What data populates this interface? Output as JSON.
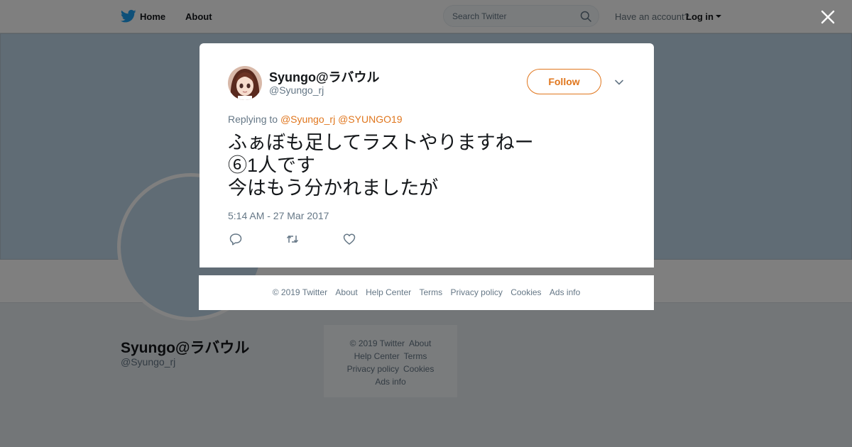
{
  "topbar": {
    "home_label": "Home",
    "about_label": "About",
    "search_placeholder": "Search Twitter",
    "have_account": "Have an account?",
    "login_label": "Log in"
  },
  "profile": {
    "name": "Syungo@ラバウル",
    "handle": "@Syungo_rj"
  },
  "side_footer": {
    "links": [
      "© 2019 Twitter",
      "About",
      "Help Center",
      "Terms",
      "Privacy policy",
      "Cookies",
      "Ads info"
    ]
  },
  "tweet": {
    "author_name": "Syungo@ラバウル",
    "author_handle": "@Syungo_rj",
    "follow_label": "Follow",
    "replying_prefix": "Replying to",
    "mentions": [
      "@Syungo_rj",
      "@SYUNGO19"
    ],
    "text_lines": [
      "ふぁぼも足してラストやりますねー",
      "⑥1人です",
      "今はもう分かれましたが"
    ],
    "timestamp": "5:14 AM - 27 Mar 2017"
  },
  "modal_footer": {
    "links": [
      "© 2019 Twitter",
      "About",
      "Help Center",
      "Terms",
      "Privacy policy",
      "Cookies",
      "Ads info"
    ]
  },
  "colors": {
    "accent": "#e0761d",
    "twitter_blue": "#1da1f2",
    "text_primary": "#14171a",
    "text_secondary": "#657786"
  },
  "icons": {
    "logo": "twitter-bird-icon",
    "search": "search-icon",
    "close": "close-icon",
    "dropdown": "chevron-down-icon",
    "reply": "reply-icon",
    "retweet": "retweet-icon",
    "like": "heart-icon"
  }
}
